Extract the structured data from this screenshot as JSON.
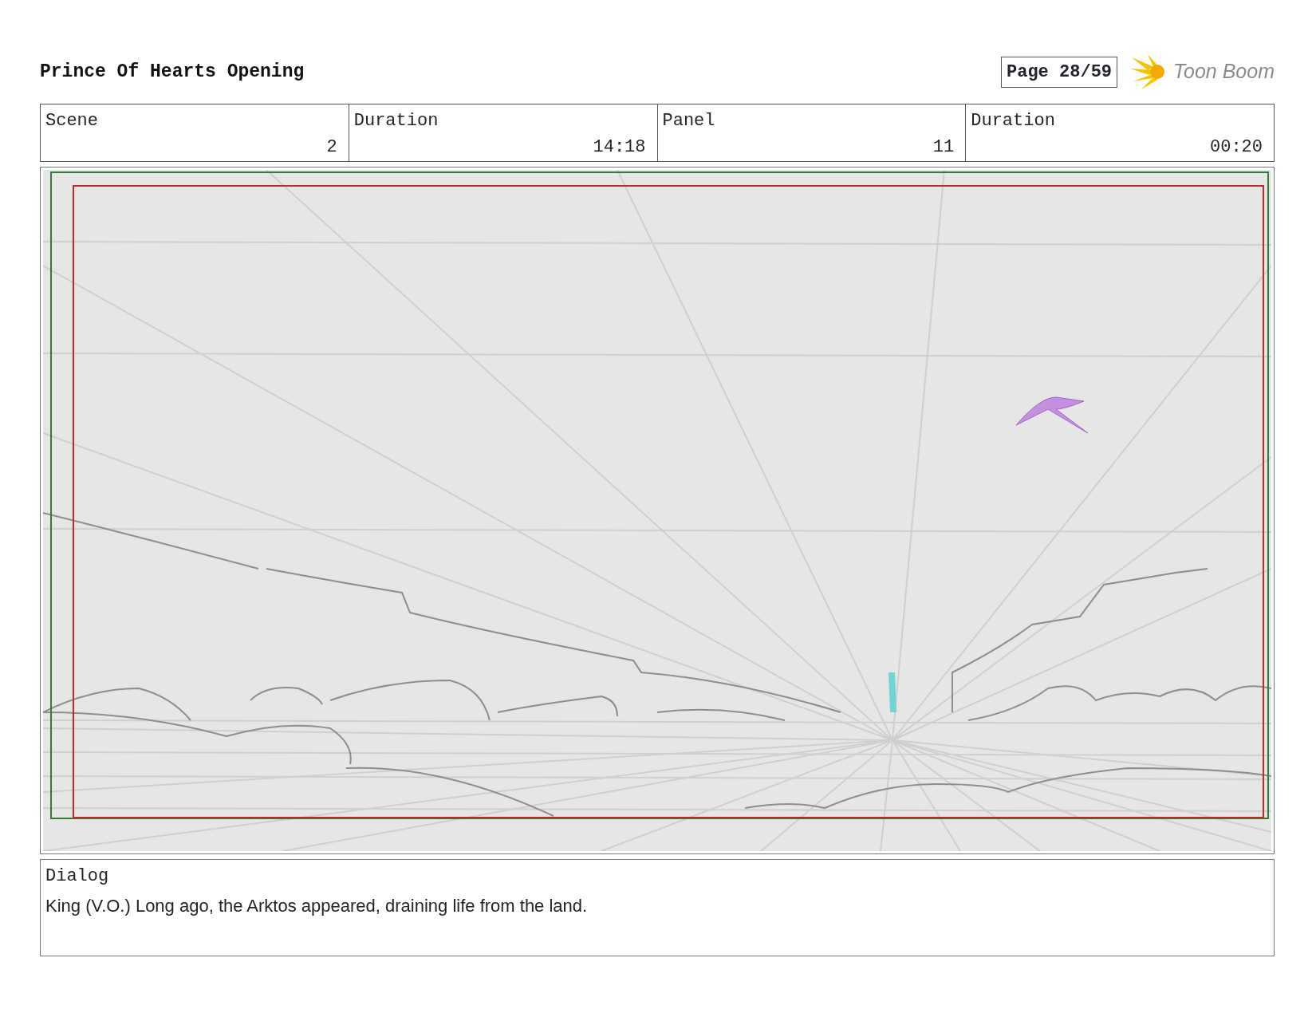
{
  "header": {
    "title": "Prince Of Hearts Opening",
    "page": "Page 28/59",
    "logo": "Toon Boom"
  },
  "info": [
    {
      "label": "Scene",
      "value": "2"
    },
    {
      "label": "Duration",
      "value": "14:18"
    },
    {
      "label": "Panel",
      "value": "11"
    },
    {
      "label": "Duration",
      "value": "00:20"
    }
  ],
  "dialog": {
    "label": "Dialog",
    "text": "King (V.O.) Long ago, the Arktos appeared, draining life from the land."
  }
}
